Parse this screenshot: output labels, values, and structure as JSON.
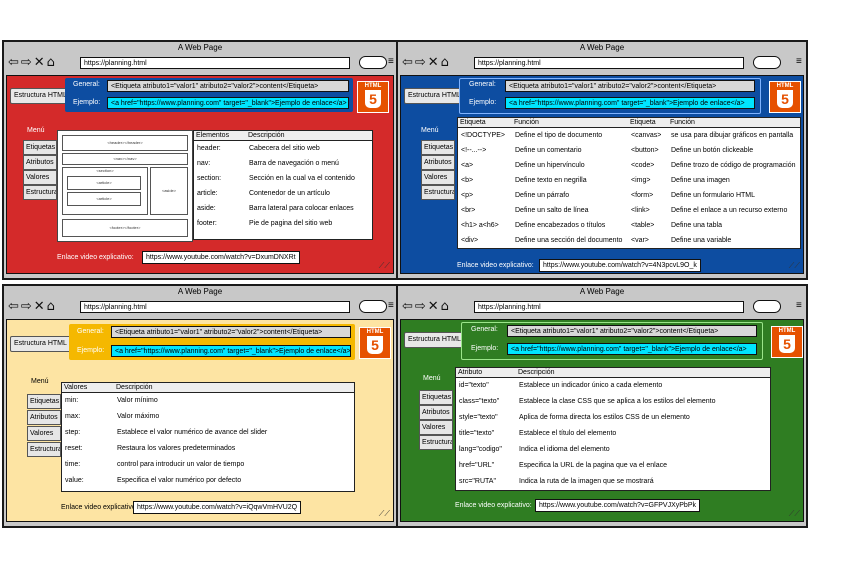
{
  "windows": {
    "w1": {
      "title": "A Web Page",
      "address": "https://planning.html",
      "structure_button": "Estructura HTML",
      "general_label": "General:",
      "general_code": "<Etiqueta atributo1=\"valor1\" atributo2=\"valor2\">content</Etiqueta>",
      "example_label": "Ejemplo:",
      "example_code": "<a href=\"https://www.planning.com\" target=\"_blank\">Ejemplo de enlace</a>",
      "menu_title": "Menú",
      "menu": [
        "Etiquetas",
        "Atributos",
        "Valores",
        "Estructura"
      ],
      "diagram": {
        "header": "<header></header>",
        "nav": "<nav></nav>",
        "section": "<section>",
        "article1": "<article>",
        "article2": "<article>",
        "aside": "<aside>",
        "footer": "<footer></footer>"
      },
      "table_headers": [
        "Elementos",
        "Descripción"
      ],
      "rows": [
        [
          "header:",
          "Cabecera del sitio web"
        ],
        [
          "nav:",
          "Barra de navegación o menú"
        ],
        [
          "section:",
          "Sección en la cual va el contenido"
        ],
        [
          "article:",
          "Contenedor de un artículo"
        ],
        [
          "aside:",
          "Barra lateral para colocar enlaces"
        ],
        [
          "footer:",
          "Pie de pagina del sitio web"
        ]
      ],
      "video_label": "Enlace video explicativo:",
      "video_url": "https://www.youtube.com/watch?v=DxumDNXRt"
    },
    "w2": {
      "title": "A Web Page",
      "address": "https://planning.html",
      "structure_button": "Estructura HTML",
      "general_label": "General:",
      "general_code": "<Etiqueta atributo1=\"valor1\" atributo2=\"valor2\">content</Etiqueta>",
      "example_label": "Ejemplo:",
      "example_code": "<a href=\"https://www.planning.com\" target=\"_blank\">Ejemplo de enlace</a>",
      "menu_title": "Menú",
      "menu": [
        "Etiquetas",
        "Atributos",
        "Valores",
        "Estructura"
      ],
      "table_headers": [
        "Etiqueta",
        "Función",
        "Etiqueta",
        "Función"
      ],
      "rows": [
        [
          "<!DOCTYPE>",
          "Define el tipo de documento",
          "<canvas>",
          "se usa para dibujar gráficos en pantalla"
        ],
        [
          "<!--...-->",
          "Define un comentario",
          "<button>",
          "Define un botón clickeable"
        ],
        [
          "<a>",
          "Define un hipervínculo",
          "<code>",
          "Define trozo de código de programación"
        ],
        [
          "<b>",
          "Define texto en negrilla",
          "<img>",
          "Define una imagen"
        ],
        [
          "<p>",
          "Define un párrafo",
          "<form>",
          "Define un formulario HTML"
        ],
        [
          "<br>",
          "Define un salto de línea",
          "<link>",
          "Define el enlace a un recurso externo"
        ],
        [
          "<h1> a<h6>",
          "Define encabezados o títulos",
          "<table>",
          "Define una tabla"
        ],
        [
          "<div>",
          "Define una sección del documento",
          "<var>",
          "Define una variable"
        ]
      ],
      "video_label": "Enlace video explicativo:",
      "video_url": "https://www.youtube.com/watch?v=4N3pcvL9O_k"
    },
    "w3": {
      "title": "A Web Page",
      "address": "https://planning.html",
      "structure_button": "Estructura HTML",
      "general_label": "General:",
      "general_code": "<Etiqueta atributo1=\"valor1\" atributo2=\"valor2\">content</Etiqueta>",
      "example_label": "Ejemplo:",
      "example_code": "<a href=\"https://www.planning.com\" target=\"_blank\">Ejemplo de enlace</a>",
      "menu_title": "Menú",
      "menu": [
        "Etiquetas",
        "Atributos",
        "Valores",
        "Estructura"
      ],
      "table_headers": [
        "Valores",
        "Descripción"
      ],
      "rows": [
        [
          "min:",
          "Valor mínimo"
        ],
        [
          "max:",
          "Valor máximo"
        ],
        [
          "step:",
          "Establece el valor numérico de avance del slider"
        ],
        [
          "reset:",
          "Restaura los valores predeterminados"
        ],
        [
          "time:",
          "control para introducir un valor de tiempo"
        ],
        [
          "value:",
          "Especifica el valor numérico  por defecto"
        ]
      ],
      "video_label": "Enlace video explicativo:",
      "video_url": "https://www.youtube.com/watch?v=iQqwVmHVU2Q"
    },
    "w4": {
      "title": "A Web Page",
      "address": "https://planning.html",
      "structure_button": "Estructura HTML",
      "general_label": "General:",
      "general_code": "<Etiqueta atributo1=\"valor1\" atributo2=\"valor2\">content</Etiqueta>",
      "example_label": "Ejemplo:",
      "example_code": "<a href=\"https://www.planning.com\" target=\"_blank\">Ejemplo de enlace</a>",
      "menu_title": "Menú",
      "menu": [
        "Etiquetas",
        "Atributos",
        "Valores",
        "Estructura"
      ],
      "table_headers": [
        "Atributo",
        "Descripción"
      ],
      "rows": [
        [
          "id=\"texto\"",
          "Establece un indicador único a cada elemento"
        ],
        [
          "class=\"texto\"",
          "Establece la clase CSS que se aplica a los estilos del elemento"
        ],
        [
          "style=\"texto\"",
          "Aplica de forma directa los estilos CSS de un elemento"
        ],
        [
          "title=\"texto\"",
          "Establece el título del elemento"
        ],
        [
          "lang=\"codigo\"",
          "Indica el idioma del elemento"
        ],
        [
          "href=\"URL\"",
          "Especifica la URL de la pagina que va el enlace"
        ],
        [
          "src=\"RUTA\"",
          "Indica la ruta de la imagen que se mostrará"
        ]
      ],
      "video_label": "Enlace video explicativo:",
      "video_url": "https://www.youtube.com/watch?v=GFPVJXyPbPk"
    }
  },
  "html5_badge": {
    "label": "HTML",
    "number": "5"
  },
  "colors": {
    "red": "#d42a2a",
    "blue": "#0d4da1",
    "yellow": "#fde4a3",
    "green": "#2f7d22",
    "code_cyan": "#00e5ff",
    "code_gray": "#d8d8d8",
    "general_bg": "#0d4da1",
    "html5_orange": "#e65100"
  }
}
